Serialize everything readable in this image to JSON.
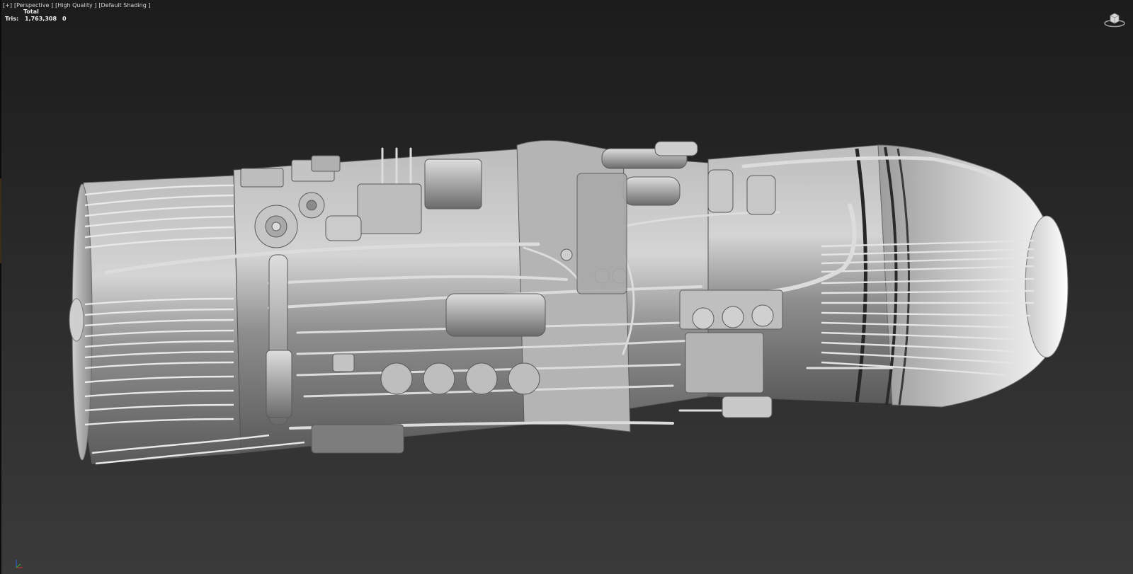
{
  "viewport_menu": {
    "plus": "[+]",
    "view": "[Perspective ]",
    "quality": "[High Quality ]",
    "shading": "[Default Shading ]"
  },
  "stats": {
    "header": "Total",
    "tris_label": "Tris:",
    "tris_total": "1,763,308",
    "tris_selected": "0"
  },
  "colors": {
    "bg_top": "#1c1c1c",
    "bg_bottom": "#3a3a3a",
    "model_base": "#9a9a9a",
    "model_highlight": "#e8e8e8",
    "model_shadow": "#4a4a4a"
  },
  "icons": {
    "viewcube": "viewcube-icon",
    "axis": "axis-tripod-icon"
  }
}
